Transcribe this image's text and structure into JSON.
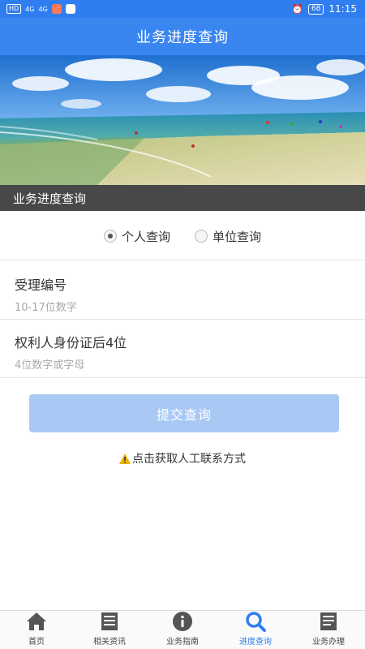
{
  "status_bar": {
    "chip1": "HD",
    "chip2": "HD",
    "signal1": "4G",
    "signal2": "4G",
    "battery": "68",
    "time": "11:15"
  },
  "header": {
    "title": "业务进度查询"
  },
  "banner": {
    "caption": "业务进度查询"
  },
  "query_type": {
    "options": [
      {
        "label": "个人查询",
        "selected": true
      },
      {
        "label": "单位查询",
        "selected": false
      }
    ]
  },
  "fields": {
    "acceptance_number": {
      "label": "受理编号",
      "placeholder": "10-17位数字",
      "value": ""
    },
    "id_last4": {
      "label": "权利人身份证后4位",
      "placeholder": "4位数字或字母",
      "value": ""
    }
  },
  "submit": {
    "label": "提交查询"
  },
  "contact": {
    "label": "点击获取人工联系方式"
  },
  "tabs": [
    {
      "label": "首页",
      "icon": "home-icon"
    },
    {
      "label": "相关资讯",
      "icon": "news-icon"
    },
    {
      "label": "业务指南",
      "icon": "info-icon"
    },
    {
      "label": "进度查询",
      "icon": "search-icon",
      "active": true
    },
    {
      "label": "业务办理",
      "icon": "document-icon"
    }
  ],
  "colors": {
    "primary": "#3a86f0",
    "button_disabled": "#a9c9f4",
    "active_tab": "#2f7ef0",
    "warning": "#f0b400"
  }
}
